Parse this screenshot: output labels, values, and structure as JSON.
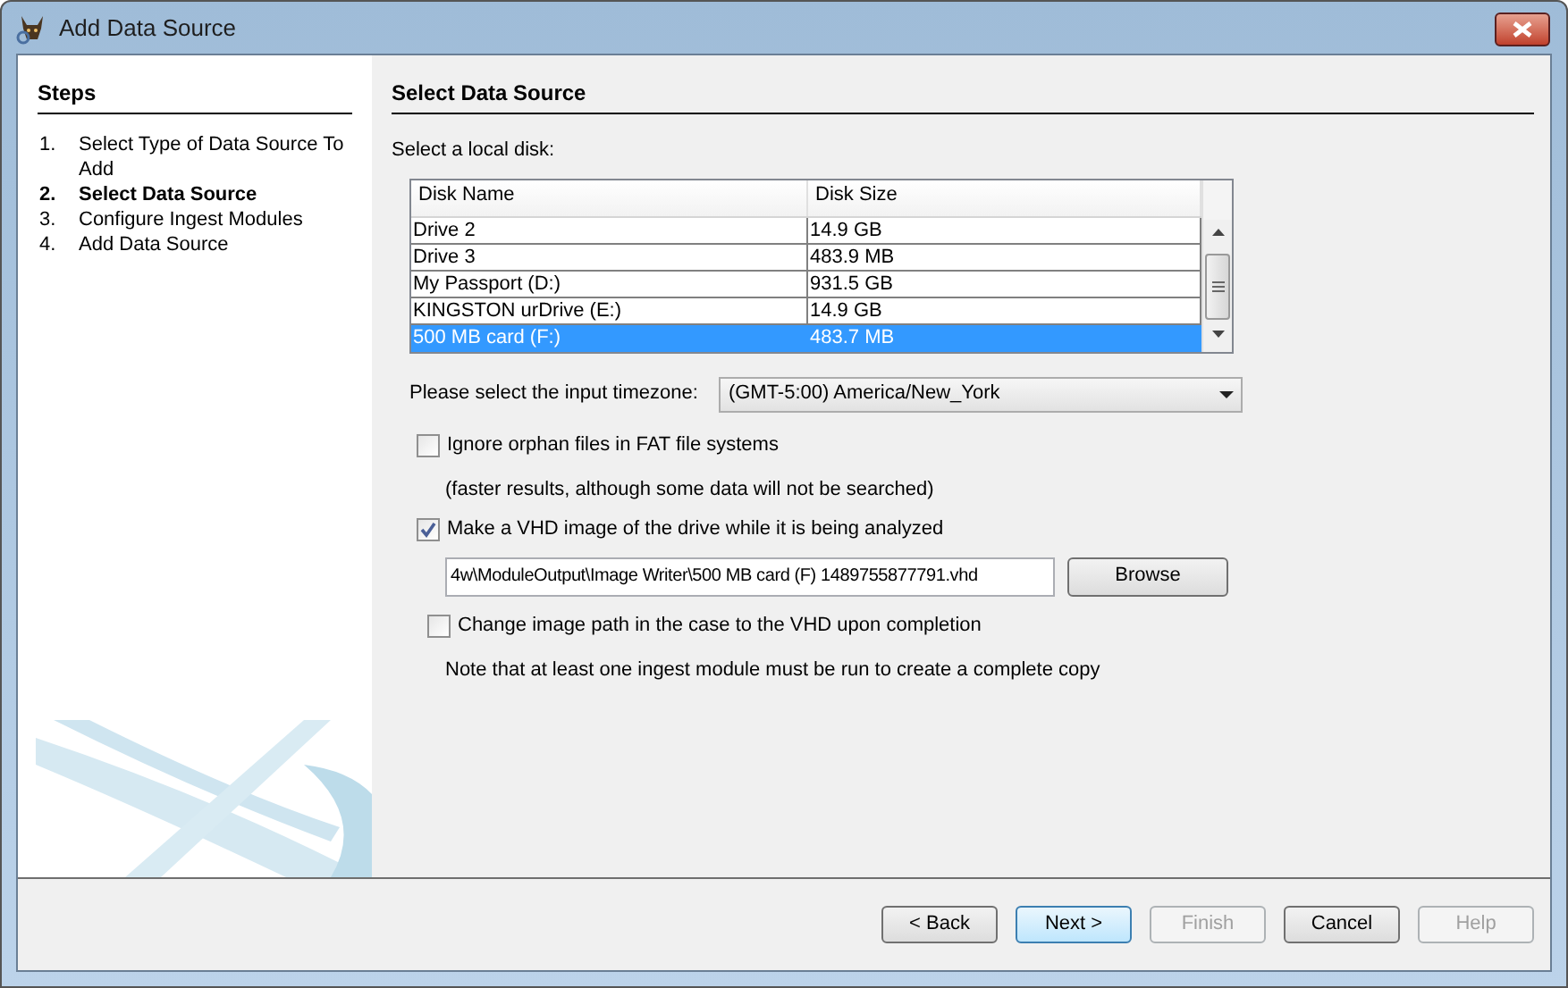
{
  "window": {
    "title": "Add Data Source"
  },
  "steps": {
    "heading": "Steps",
    "items": [
      {
        "number": "1.",
        "label": "Select Type of Data Source To Add",
        "selected": false
      },
      {
        "number": "2.",
        "label": "Select Data Source",
        "selected": true
      },
      {
        "number": "3.",
        "label": "Configure Ingest Modules",
        "selected": false
      },
      {
        "number": "4.",
        "label": "Add Data Source",
        "selected": false
      }
    ]
  },
  "panel": {
    "heading": "Select Data Source",
    "disk_label": "Select a local disk:",
    "table": {
      "columns": [
        "Disk Name",
        "Disk Size"
      ],
      "rows": [
        {
          "cells": [
            "Drive 2",
            "14.9 GB"
          ],
          "selected": false
        },
        {
          "cells": [
            "Drive 3",
            "483.9 MB"
          ],
          "selected": false
        },
        {
          "cells": [
            "My Passport (D:)",
            "931.5 GB"
          ],
          "selected": false
        },
        {
          "cells": [
            "KINGSTON urDrive (E:)",
            "14.9 GB"
          ],
          "selected": false
        },
        {
          "cells": [
            "500 MB card (F:)",
            "483.7 MB"
          ],
          "selected": true
        }
      ]
    },
    "timezone": {
      "label": "Please select the input timezone:",
      "value": "(GMT-5:00) America/New_York"
    },
    "options": [
      {
        "kind": "checkbox",
        "label": "Ignore orphan files in FAT file systems",
        "checked": false
      },
      {
        "kind": "note",
        "label": "(faster results, although some data will not be searched)"
      },
      {
        "kind": "checkbox",
        "label": "Make a VHD image of the drive while it is being analyzed",
        "checked": true
      },
      {
        "kind": "path",
        "value": "4w\\ModuleOutput\\Image Writer\\500 MB card (F) 1489755877791.vhd",
        "button": "Browse"
      },
      {
        "kind": "checkbox",
        "label": "Change image path in the case to the VHD upon completion",
        "checked": false,
        "indent": true
      },
      {
        "kind": "note",
        "label": "Note that at least one ingest module must be run to create a complete copy"
      }
    ]
  },
  "buttons": [
    {
      "label": "< Back",
      "disabled": false,
      "default": false
    },
    {
      "label": "Next >",
      "disabled": false,
      "default": true
    },
    {
      "label": "Finish",
      "disabled": true,
      "default": false
    },
    {
      "label": "Cancel",
      "disabled": false,
      "default": false
    },
    {
      "label": "Help",
      "disabled": true,
      "default": false
    }
  ]
}
